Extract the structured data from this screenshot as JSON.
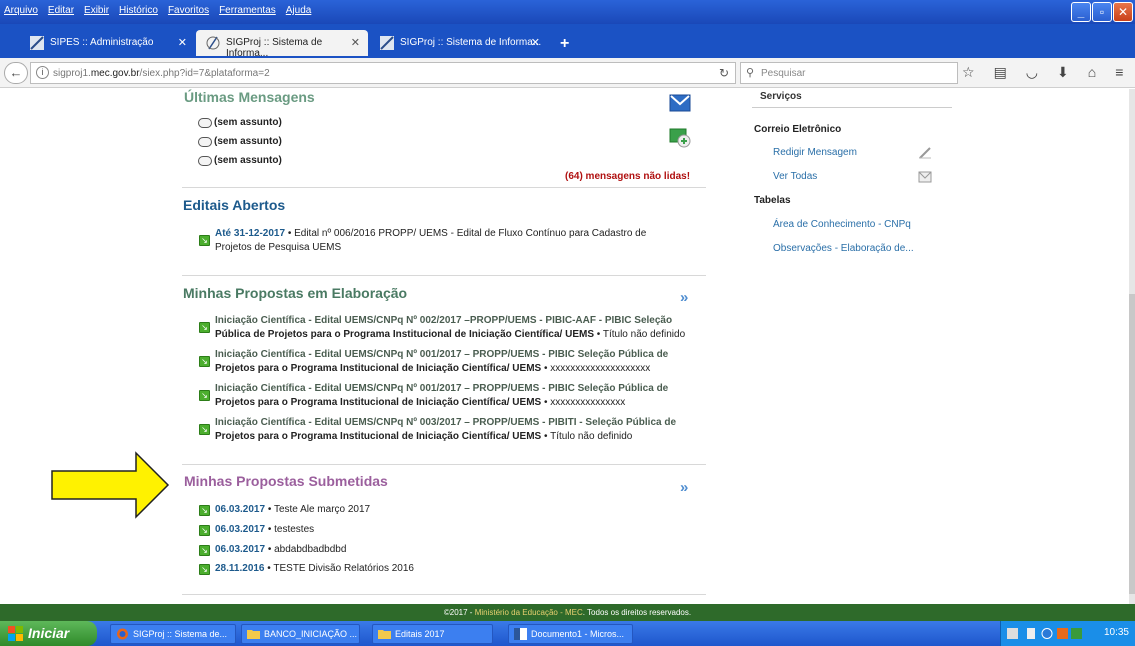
{
  "menubar": {
    "items": [
      "Arquivo",
      "Editar",
      "Exibir",
      "Histórico",
      "Favoritos",
      "Ferramentas",
      "Ajuda"
    ]
  },
  "tabs": [
    {
      "label": "SIPES :: Administração"
    },
    {
      "label": "SIGProj :: Sistema de Informa..."
    },
    {
      "label": "SIGProj :: Sistema de Informa..."
    }
  ],
  "address": {
    "prefix": "sigproj1.",
    "domain": "mec.gov.br",
    "path": "/siex.php?id=7&plataforma=2",
    "search_placeholder": "Pesquisar"
  },
  "messages": {
    "title": "Últimas Mensagens",
    "items": [
      "(sem assunto)",
      "(sem assunto)",
      "(sem assunto)"
    ],
    "unread": "(64) mensagens não lidas!"
  },
  "editais": {
    "title": "Editais Abertos",
    "date": "Até 31-12-2017",
    "line1": " • Edital nº 006/2016 PROPP/ UEMS - Edital de Fluxo Contínuo para Cadastro de",
    "line2": "Projetos de Pesquisa UEMS"
  },
  "elaboracao": {
    "title": "Minhas Propostas em Elaboração",
    "items": [
      {
        "l1": "Iniciação Científica - Edital UEMS/CNPq Nº 002/2017 –PROPP/UEMS - PIBIC-AAF - PIBIC Seleção",
        "l2": "Pública de Projetos para o Programa Institucional de Iniciação Científica/ UEMS",
        "suffix": " • Título não definido"
      },
      {
        "l1": "Iniciação Científica - Edital UEMS/CNPq Nº 001/2017 – PROPP/UEMS - PIBIC Seleção Pública de",
        "l2": "Projetos para o Programa Institucional de Iniciação Científica/ UEMS",
        "suffix": " • xxxxxxxxxxxxxxxxxxxx"
      },
      {
        "l1": "Iniciação Científica - Edital UEMS/CNPq Nº 001/2017 – PROPP/UEMS - PIBIC Seleção Pública de",
        "l2": "Projetos para o Programa Institucional de Iniciação Científica/ UEMS",
        "suffix": " • xxxxxxxxxxxxxxx"
      },
      {
        "l1": "Iniciação Científica - Edital UEMS/CNPq Nº 003/2017 – PROPP/UEMS - PIBITI - Seleção Pública de",
        "l2": "Projetos para o Programa Institucional de Iniciação Científica/ UEMS",
        "suffix": " • Título não definido"
      }
    ]
  },
  "submetidas": {
    "title": "Minhas Propostas Submetidas",
    "items": [
      {
        "date": "06.03.2017",
        "text": " • Teste Ale março 2017"
      },
      {
        "date": "06.03.2017",
        "text": " • testestes"
      },
      {
        "date": "06.03.2017",
        "text": " • abdabdbadbdbd"
      },
      {
        "date": "28.11.2016",
        "text": " • TESTE Divisão Relatórios 2016"
      }
    ]
  },
  "sidebar": {
    "head": "Serviços",
    "correio": "Correio Eletrônico",
    "redigir": "Redigir Mensagem",
    "ver": "Ver Todas",
    "tabelas": "Tabelas",
    "area": "Área de Conhecimento - CNPq",
    "obs": "Observações - Elaboração de..."
  },
  "footer": {
    "pre": "©2017 - ",
    "link": "Ministério da Educação - MEC",
    "post": ". Todos os direitos reservados."
  },
  "taskbar": {
    "start": "Iniciar",
    "tasks": [
      "SIGProj :: Sistema de...",
      "BANCO_INICIAÇÃO ...",
      "Editais 2017",
      "Documento1 - Micros..."
    ],
    "clock": "10:35"
  }
}
